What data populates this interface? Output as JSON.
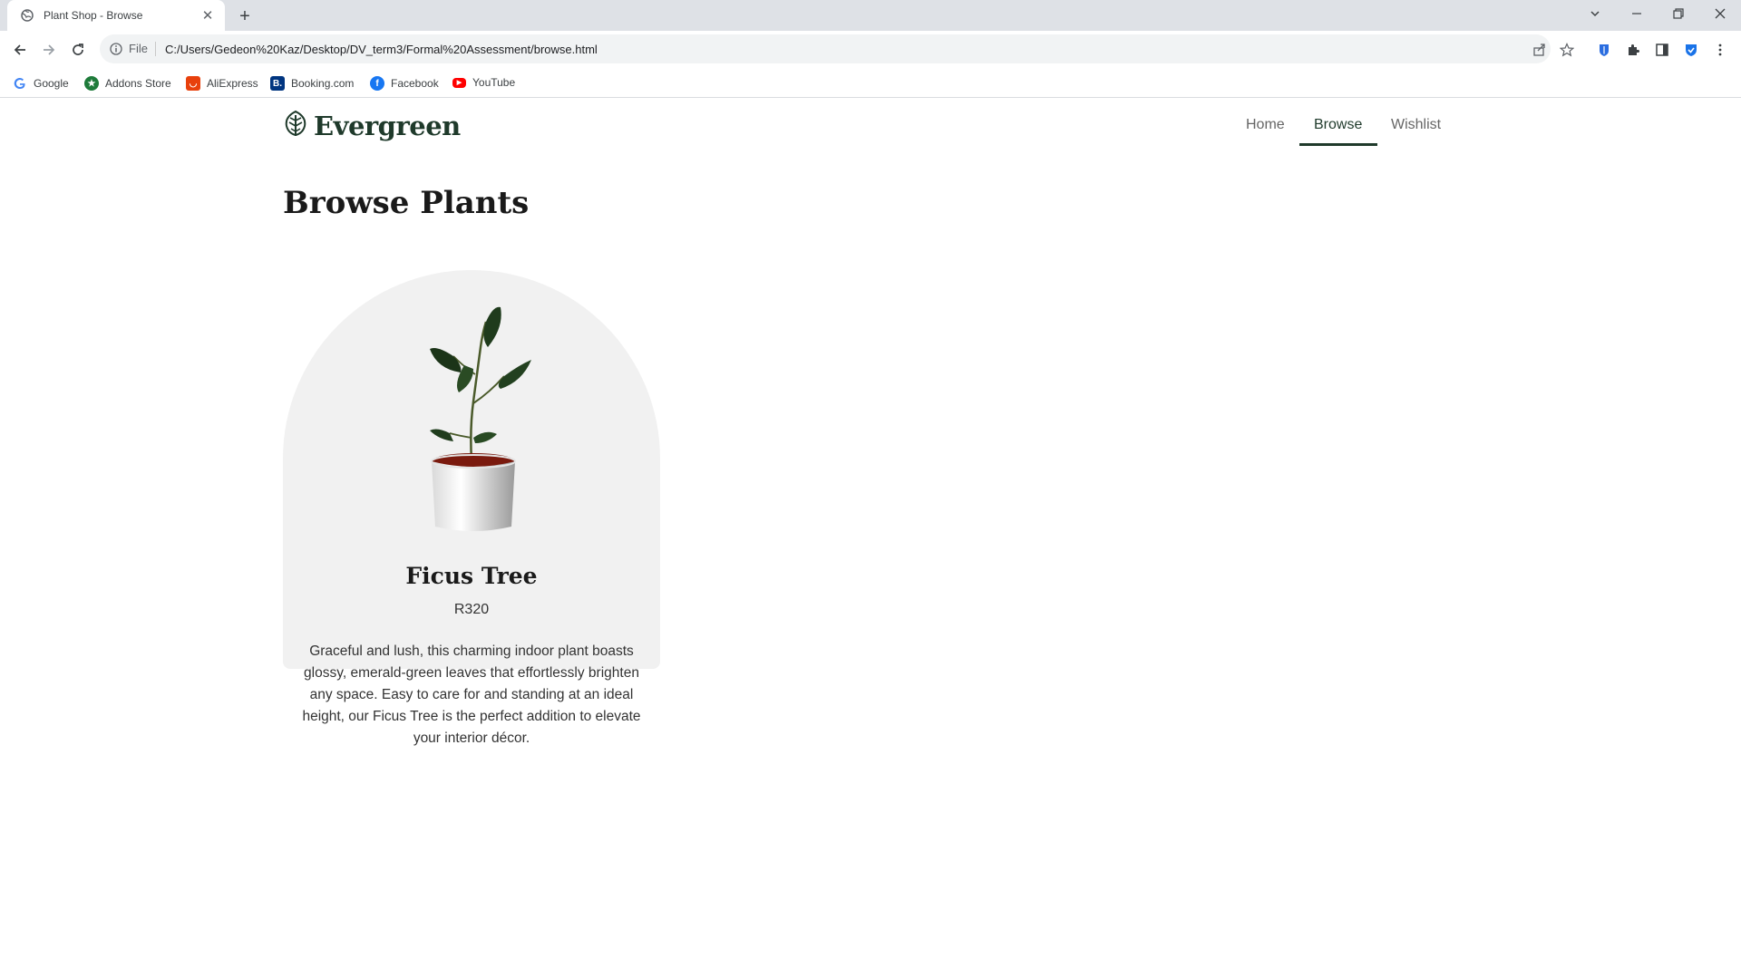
{
  "browser": {
    "tab_title": "Plant Shop - Browse",
    "address_scheme": "File",
    "address_url": "C:/Users/Gedeon%20Kaz/Desktop/DV_term3/Formal%20Assessment/browse.html"
  },
  "bookmarks": [
    {
      "label": "Google",
      "icon": "google-icon",
      "color": "#4285f4"
    },
    {
      "label": "Addons Store",
      "icon": "addons-store-icon",
      "color": "#1e7b3a"
    },
    {
      "label": "AliExpress",
      "icon": "aliexpress-icon",
      "color": "#e8400c"
    },
    {
      "label": "Booking.com",
      "icon": "booking-icon",
      "color": "#003580"
    },
    {
      "label": "Facebook",
      "icon": "facebook-icon",
      "color": "#1877f2"
    },
    {
      "label": "YouTube",
      "icon": "youtube-icon",
      "color": "#ff0000"
    }
  ],
  "site": {
    "brand": "Evergreen",
    "brand_color": "#1f3a2b",
    "nav": [
      {
        "label": "Home",
        "active": false
      },
      {
        "label": "Browse",
        "active": true
      },
      {
        "label": "Wishlist",
        "active": false
      }
    ]
  },
  "main": {
    "title": "Browse Plants",
    "products": [
      {
        "name": "Ficus Tree",
        "price": "R320",
        "description": "Graceful and lush, this charming indoor plant boasts glossy, emerald-green leaves that effortlessly brighten any space. Easy to care for and standing at an ideal height, our Ficus Tree is the perfect addition to elevate your interior décor."
      }
    ]
  }
}
